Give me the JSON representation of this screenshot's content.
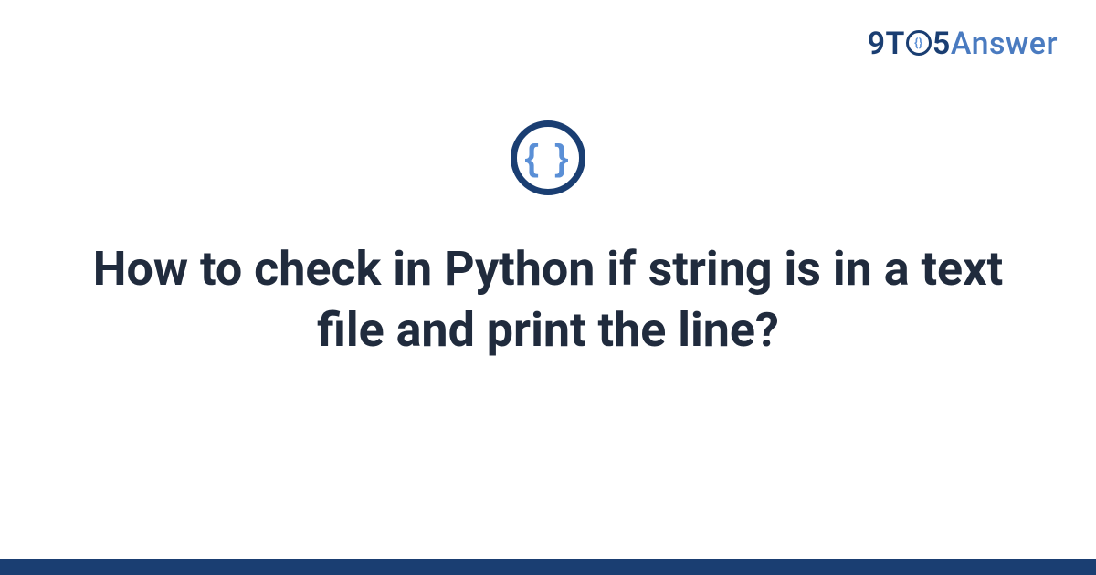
{
  "brand": {
    "nine_t": "9T",
    "inner_brace": "{}",
    "five": "5",
    "answer": "Answer"
  },
  "icon": {
    "braces": "{ }"
  },
  "title": "How to check in Python if string is in a text file and print the line?"
}
